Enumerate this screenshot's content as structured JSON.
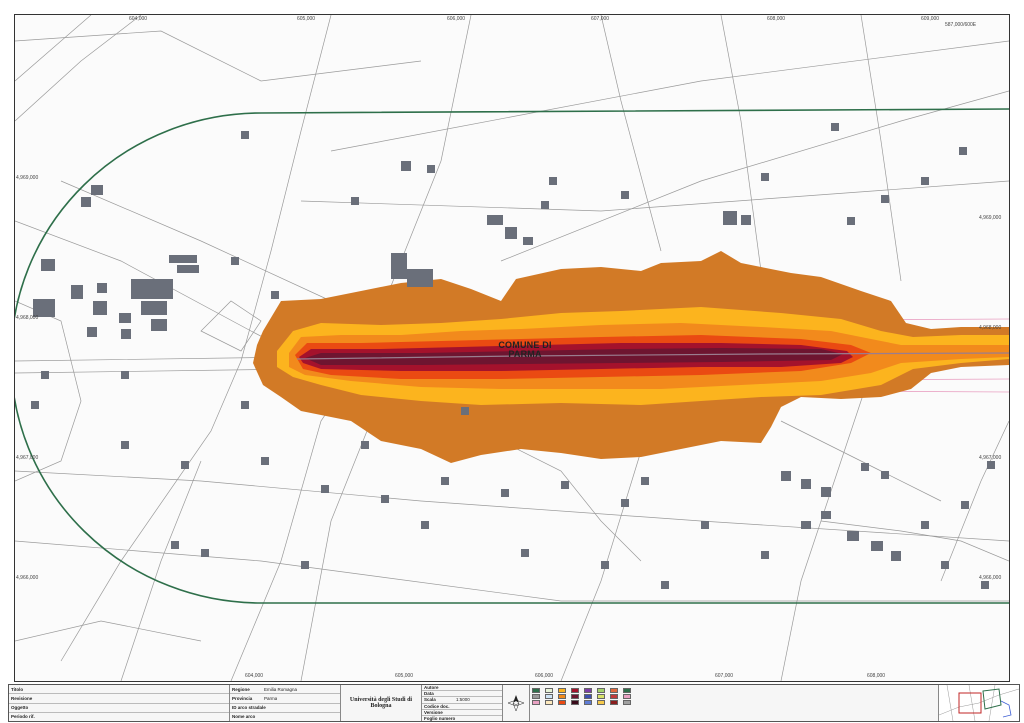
{
  "map": {
    "place_label_line1": "COMUNE DI",
    "place_label_line2": "PARMA",
    "colors": {
      "zone_outer": "#d27a26",
      "zone_mid_yellow": "#fcb41e",
      "zone_orange": "#f28a1c",
      "zone_red_orange": "#ea4a12",
      "zone_dark_red": "#a4122c",
      "zone_core": "#6e1530",
      "study_boundary": "#2e6f4a",
      "road": "#9a9a9a",
      "building": "#6a6f7a",
      "pink_lines": "#e9a2c3"
    },
    "coordinates": {
      "top": [
        "604,000",
        "605,000",
        "606,000",
        "607,000",
        "608,000",
        "609,000",
        "587,000/600E"
      ],
      "bottom": [
        "604,000",
        "605,000",
        "606,000",
        "607,000",
        "608,000"
      ],
      "left": [
        "4,969,000",
        "4,968,000",
        "4,967,000",
        "4,966,000"
      ],
      "right": [
        "4,969,000",
        "4,968,000",
        "4,967,000",
        "4,966,000"
      ]
    }
  },
  "title_block": {
    "rows": [
      {
        "key": "Titolo",
        "value": ""
      },
      {
        "key": "Revisione",
        "value": ""
      },
      {
        "key": "Oggetto",
        "value": ""
      },
      {
        "key": "Periodo rif.",
        "value": ""
      }
    ],
    "region_rows": [
      {
        "key": "Regione",
        "value": "Emilia Romagna"
      },
      {
        "key": "Provincia",
        "value": "Parma"
      },
      {
        "key": "ID arco stradale",
        "value": ""
      },
      {
        "key": "Nome arco",
        "value": ""
      }
    ],
    "author_rows": [
      {
        "key": "Autore",
        "value": ""
      },
      {
        "key": "Data",
        "value": ""
      },
      {
        "key": "Scala",
        "value": "1:5000"
      },
      {
        "key": "Codice doc.",
        "value": ""
      },
      {
        "key": "Versione",
        "value": ""
      },
      {
        "key": "Foglio numero",
        "value": ""
      }
    ],
    "university": "Università degli Studi di Bologna",
    "department_lines": [
      "",
      ""
    ]
  },
  "legend": {
    "groups": [
      {
        "title": "",
        "items": [
          {
            "label": "",
            "color": "#2e6f4a"
          },
          {
            "label": "",
            "color": "#999999"
          },
          {
            "label": "",
            "color": "#e9a2c3"
          }
        ]
      },
      {
        "title": "",
        "items": [
          {
            "label": "",
            "color": "#e7f3d7"
          },
          {
            "label": "",
            "color": "#cfe4f6"
          },
          {
            "label": "",
            "color": "#fde9bd"
          }
        ]
      },
      {
        "title": "",
        "items": [
          {
            "label": "",
            "color": "#fcb41e"
          },
          {
            "label": "",
            "color": "#f28a1c"
          },
          {
            "label": "",
            "color": "#ea4a12"
          }
        ]
      },
      {
        "title": "",
        "items": [
          {
            "label": "",
            "color": "#a4122c"
          },
          {
            "label": "",
            "color": "#6e1530"
          },
          {
            "label": "",
            "color": "#3a0a1a"
          }
        ]
      },
      {
        "title": "",
        "items": [
          {
            "label": "",
            "color": "#7d3da6"
          },
          {
            "label": "",
            "color": "#3e4fb0"
          },
          {
            "label": "",
            "color": "#5e7bd4"
          }
        ]
      },
      {
        "title": "",
        "items": [
          {
            "label": "",
            "color": "#a3d36a"
          },
          {
            "label": "",
            "color": "#d8e36a"
          },
          {
            "label": "",
            "color": "#f6c94a"
          }
        ]
      },
      {
        "title": "",
        "items": [
          {
            "label": "",
            "color": "#e1683c"
          },
          {
            "label": "",
            "color": "#c23a3a"
          },
          {
            "label": "",
            "color": "#8a1d1d"
          }
        ]
      },
      {
        "title": "",
        "items": [
          {
            "label": "",
            "color": "#2e6f4a"
          },
          {
            "label": "",
            "color": "#e9a2c3"
          },
          {
            "label": "",
            "color": "#a1a1a1"
          }
        ]
      }
    ]
  },
  "icons": {
    "north_arrow": "north-arrow-icon",
    "inset_map": "inset-map"
  }
}
